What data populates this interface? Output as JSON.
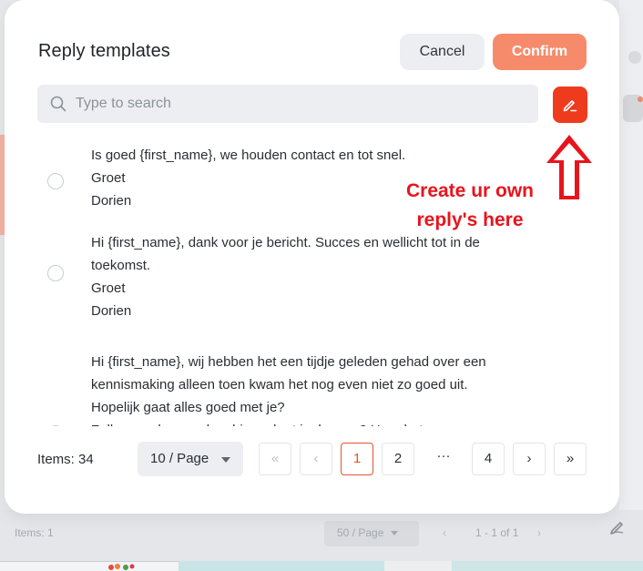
{
  "modal": {
    "title": "Reply templates",
    "cancel_label": "Cancel",
    "confirm_label": "Confirm"
  },
  "search": {
    "placeholder": "Type to search",
    "value": ""
  },
  "create_button": {
    "icon": "pen-icon"
  },
  "annotation": {
    "line1": "Create ur own",
    "line2": "reply's here"
  },
  "templates": [
    {
      "lines": [
        "Is goed {first_name}, we houden contact en tot snel.",
        "Groet",
        "Dorien"
      ],
      "selected": false
    },
    {
      "lines": [
        "Hi {first_name}, dank voor je bericht. Succes en wellicht tot in de",
        "toekomst.",
        "Groet",
        "Dorien"
      ],
      "selected": false
    },
    {
      "lines": [
        "Hi {first_name}, wij hebben het een tijdje geleden gehad over een",
        "kennismaking alleen toen kwam het nog even niet zo goed uit.",
        "Hopelijk gaat alles goed met je?",
        "Zullen we deze anders binnenkort inplannen? Hoor het graag."
      ],
      "selected": false
    }
  ],
  "pagination": {
    "items_label": "Items: 34",
    "page_size": "10 / Page",
    "first": "«",
    "prev": "‹",
    "pages": [
      "1",
      "2"
    ],
    "ellipsis": "···",
    "last_page": "4",
    "next": "›",
    "last": "»",
    "current_page": "1"
  },
  "background": {
    "items_label": "Items: 1",
    "page_size": "50 / Page",
    "range": "1 - 1 of 1"
  },
  "colors": {
    "accent": "#f68b6c",
    "create_button": "#ef3b1d",
    "annotation": "#e8141c",
    "active_page": "#e2552f"
  }
}
